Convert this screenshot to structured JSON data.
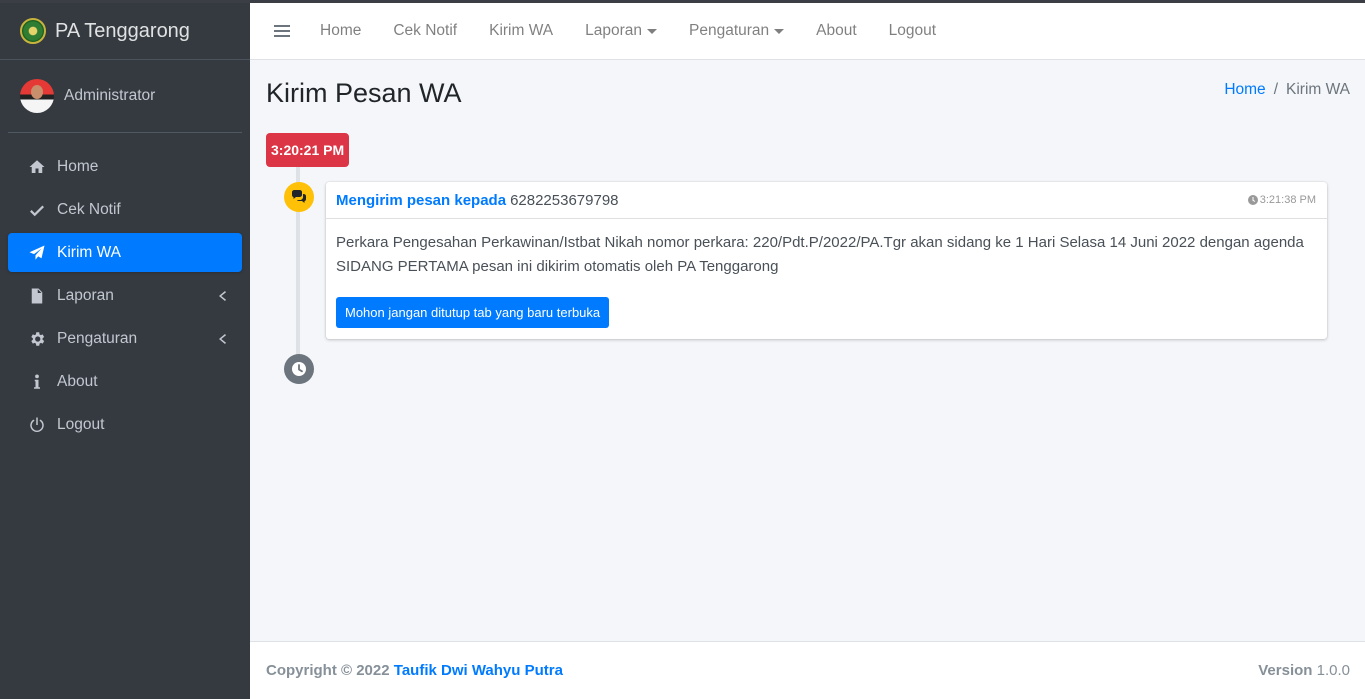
{
  "brand": {
    "title": "PA Tenggarong",
    "logo_icon": "court-emblem-logo"
  },
  "user": {
    "name": "Administrator",
    "avatar_icon": "user-avatar"
  },
  "sidebar": {
    "items": [
      {
        "label": "Home",
        "icon": "home-icon",
        "active": false
      },
      {
        "label": "Cek Notif",
        "icon": "check-icon",
        "active": false
      },
      {
        "label": "Kirim WA",
        "icon": "paper-plane-icon",
        "active": true
      },
      {
        "label": "Laporan",
        "icon": "file-icon",
        "active": false,
        "submenu": true
      },
      {
        "label": "Pengaturan",
        "icon": "gear-icon",
        "active": false,
        "submenu": true
      },
      {
        "label": "About",
        "icon": "info-icon",
        "active": false
      },
      {
        "label": "Logout",
        "icon": "power-icon",
        "active": false
      }
    ]
  },
  "topnav": {
    "items": [
      "Home",
      "Cek Notif",
      "Kirim WA",
      "Laporan",
      "Pengaturan",
      "About",
      "Logout"
    ]
  },
  "page": {
    "title": "Kirim Pesan WA",
    "breadcrumb": {
      "home": "Home",
      "separator": "/",
      "current": "Kirim WA"
    }
  },
  "timeline": {
    "time_label": "3:20:21 PM",
    "item": {
      "sender_label": "Mengirim pesan kepada",
      "number": "6282253679798",
      "time": "3:21:38 PM",
      "body": "Perkara Pengesahan Perkawinan/Istbat Nikah nomor perkara: 220/Pdt.P/2022/PA.Tgr akan sidang ke 1 Hari Selasa 14 Juni 2022 dengan agenda SIDANG PERTAMA pesan ini dikirim otomatis oleh PA Tenggarong",
      "button_label": "Mohon jangan ditutup tab yang baru terbuka"
    }
  },
  "footer": {
    "copyright": "Copyright © 2022",
    "author": "Taufik Dwi Wahyu Putra",
    "version_label": "Version",
    "version": "1.0.0"
  },
  "colors": {
    "sidebar_bg": "#343a40",
    "primary": "#007bff",
    "danger": "#dc3545",
    "warning": "#ffc107"
  }
}
